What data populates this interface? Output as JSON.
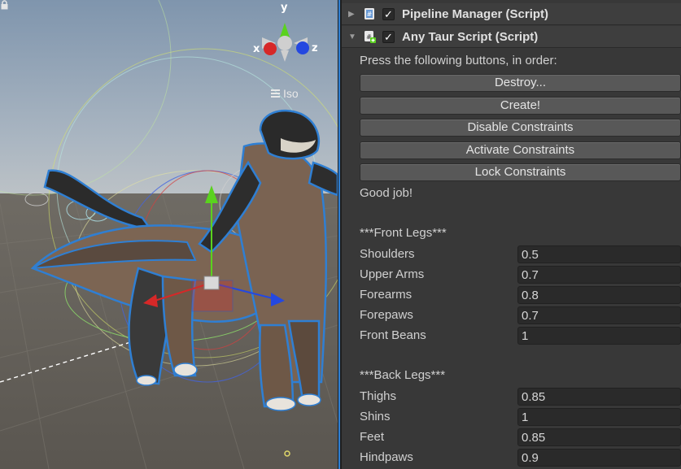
{
  "scene": {
    "view_mode": "Iso",
    "gizmo_axes": {
      "x": "x",
      "y": "y",
      "z": "z"
    }
  },
  "components": [
    {
      "title": "Pipeline Manager (Script)",
      "enabled": true,
      "expanded": false,
      "icon": "script-icon"
    },
    {
      "title": "Any Taur Script (Script)",
      "enabled": true,
      "expanded": true,
      "icon": "script-icon"
    }
  ],
  "any_taur": {
    "instructions": "Press the following buttons, in order:",
    "buttons": [
      "Destroy...",
      "Create!",
      "Disable Constraints",
      "Activate Constraints",
      "Lock Constraints"
    ],
    "status": "Good job!",
    "front_header": "***Front Legs***",
    "front_fields": [
      {
        "label": "Shoulders",
        "value": "0.5"
      },
      {
        "label": "Upper Arms",
        "value": "0.7"
      },
      {
        "label": "Forearms",
        "value": "0.8"
      },
      {
        "label": "Forepaws",
        "value": "0.7"
      },
      {
        "label": "Front Beans",
        "value": "1"
      }
    ],
    "back_header": "***Back Legs***",
    "back_fields": [
      {
        "label": "Thighs",
        "value": "0.85"
      },
      {
        "label": "Shins",
        "value": "1"
      },
      {
        "label": "Feet",
        "value": "0.85"
      },
      {
        "label": "Hindpaws",
        "value": "0.9"
      }
    ]
  },
  "colors": {
    "selection_outline": "#2f7fd3",
    "axis_x": "#d62828",
    "axis_y": "#5ad21e",
    "axis_z": "#2448e0"
  }
}
